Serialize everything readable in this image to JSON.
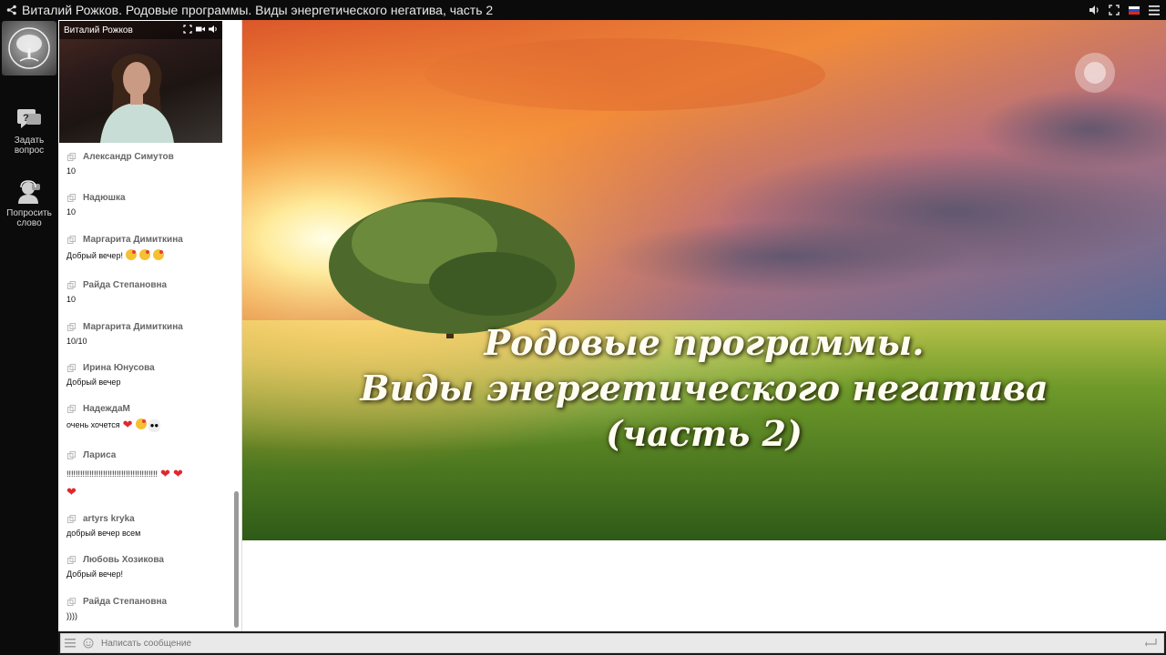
{
  "window": {
    "title": "Виталий Рожков. Родовые программы. Виды энергетического негатива, часть 2"
  },
  "rail": {
    "ask_label_1": "Задать",
    "ask_label_2": "вопрос",
    "speak_label_1": "Попросить",
    "speak_label_2": "слово"
  },
  "video": {
    "speaker_name": "Виталий Рожков"
  },
  "messages": [
    {
      "author": "Александр Симутов",
      "text": "10"
    },
    {
      "author": "Надюшка",
      "text": "10"
    },
    {
      "author": "Маргарита Димиткина",
      "text": "Добрый вечер!"
    },
    {
      "author": "Райда Степановна",
      "text": "10"
    },
    {
      "author": "Маргарита Димиткина",
      "text": "10/10"
    },
    {
      "author": "Ирина Юнусова",
      "text": "Добрый вечер"
    },
    {
      "author": "НадеждаМ",
      "text": "очень хочется"
    },
    {
      "author": "Лариса",
      "text": "!!!!!!!!!!!!!!!!!!!!!!!!!!!!!!!!!!!!!!!!"
    },
    {
      "author": "artyrs kryka",
      "text": "добрый вечер всем"
    },
    {
      "author": "Любовь Хозикова",
      "text": "Добрый вечер!"
    },
    {
      "author": "Райда Степановна",
      "text": "))))"
    }
  ],
  "slide": {
    "line1": "Родовые программы.",
    "line2": "Виды энергетического негатива",
    "line3": "(часть 2)"
  },
  "composer": {
    "placeholder": "Написать сообщение"
  },
  "colors": {
    "heart": "#e0282e",
    "emoji_face": "#f5c132"
  }
}
